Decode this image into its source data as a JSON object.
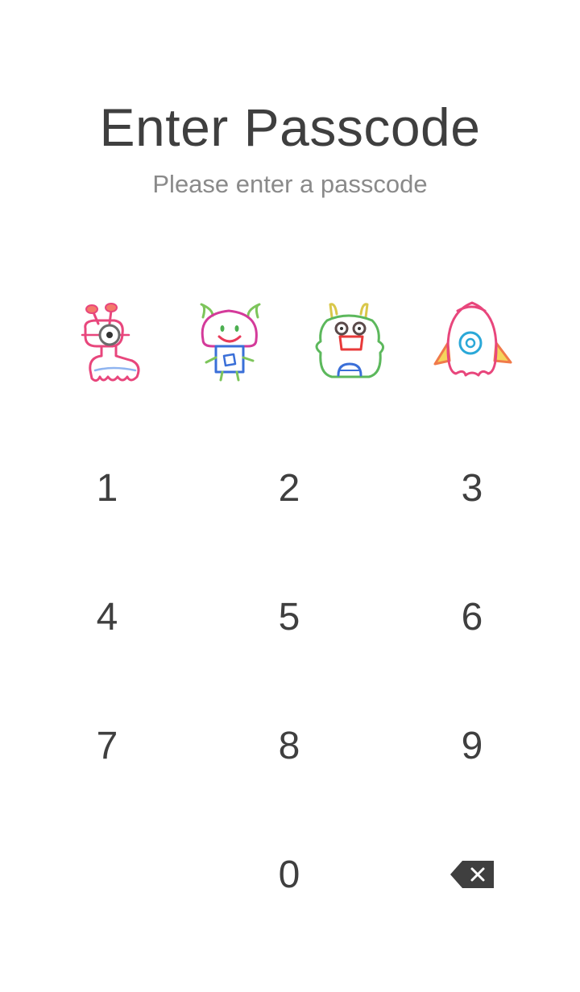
{
  "header": {
    "title": "Enter Passcode",
    "subtitle": "Please enter a passcode"
  },
  "passcode_slots": [
    {
      "icon": "one-eyed-monster-icon",
      "color": "#e8467c"
    },
    {
      "icon": "horned-mushroom-monster-icon",
      "color": "#d43a9a"
    },
    {
      "icon": "bunny-monster-icon",
      "color": "#5cb85c"
    },
    {
      "icon": "rocket-icon",
      "color": "#e8467c"
    }
  ],
  "keypad": {
    "keys": [
      "1",
      "2",
      "3",
      "4",
      "5",
      "6",
      "7",
      "8",
      "9",
      "0"
    ],
    "backspace_icon": "backspace-icon"
  },
  "colors": {
    "text": "#3f3f3f",
    "subtitle": "#8a8a8a",
    "background": "#ffffff"
  }
}
